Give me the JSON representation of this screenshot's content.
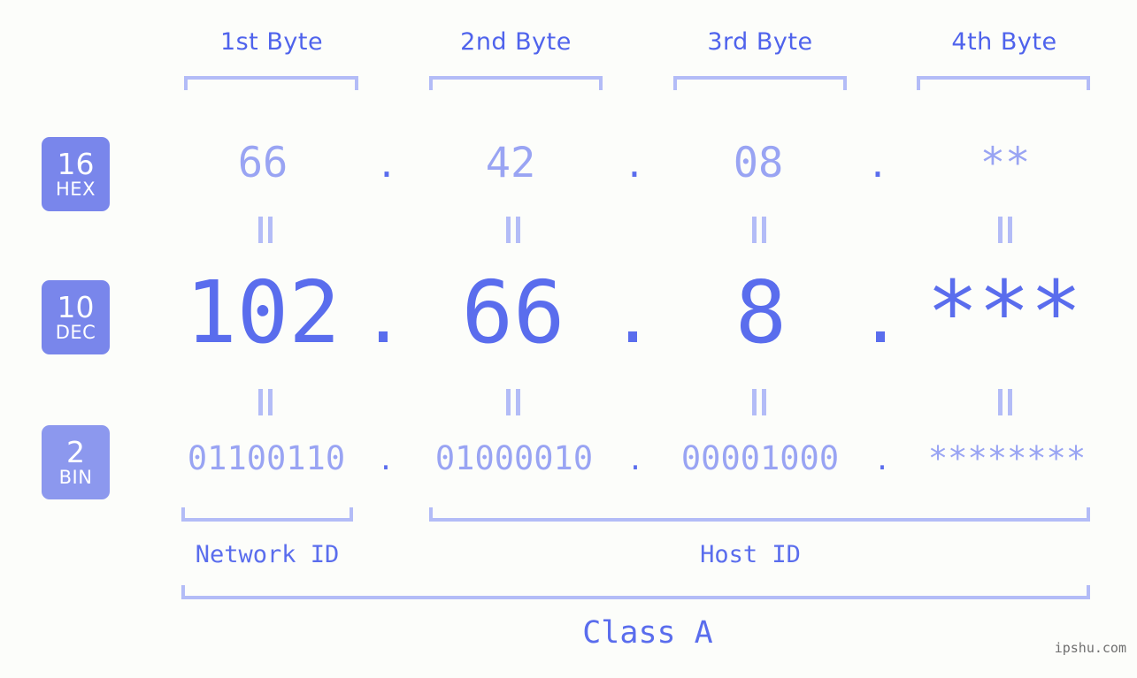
{
  "background_color": "#fcfdfa",
  "accent_color": "#5a6ded",
  "accent_light_color": "#99a4f3",
  "bracket_color": "#b3bcf7",
  "badge_color": "#7986eb",
  "badge_color_light": "#8c98ee",
  "byte_headers": [
    {
      "label": "1st Byte"
    },
    {
      "label": "2nd Byte"
    },
    {
      "label": "3rd Byte"
    },
    {
      "label": "4th Byte"
    }
  ],
  "bases": [
    {
      "number": "16",
      "name": "HEX"
    },
    {
      "number": "10",
      "name": "DEC"
    },
    {
      "number": "2",
      "name": "BIN"
    }
  ],
  "rows": {
    "hex": {
      "values": [
        "66",
        "42",
        "08",
        "**"
      ],
      "separators": [
        ".",
        ".",
        "."
      ]
    },
    "dec": {
      "values": [
        "102",
        "66",
        "8",
        "***"
      ],
      "separators": [
        ".",
        ".",
        "."
      ]
    },
    "bin": {
      "values": [
        "01100110",
        "01000010",
        "00001000",
        "********"
      ],
      "separators": [
        ".",
        ".",
        "."
      ]
    }
  },
  "equals_symbol": "=",
  "segments": [
    {
      "label": "Network ID"
    },
    {
      "label": "Host ID"
    }
  ],
  "class_label": "Class A",
  "watermark": "ipshu.com"
}
